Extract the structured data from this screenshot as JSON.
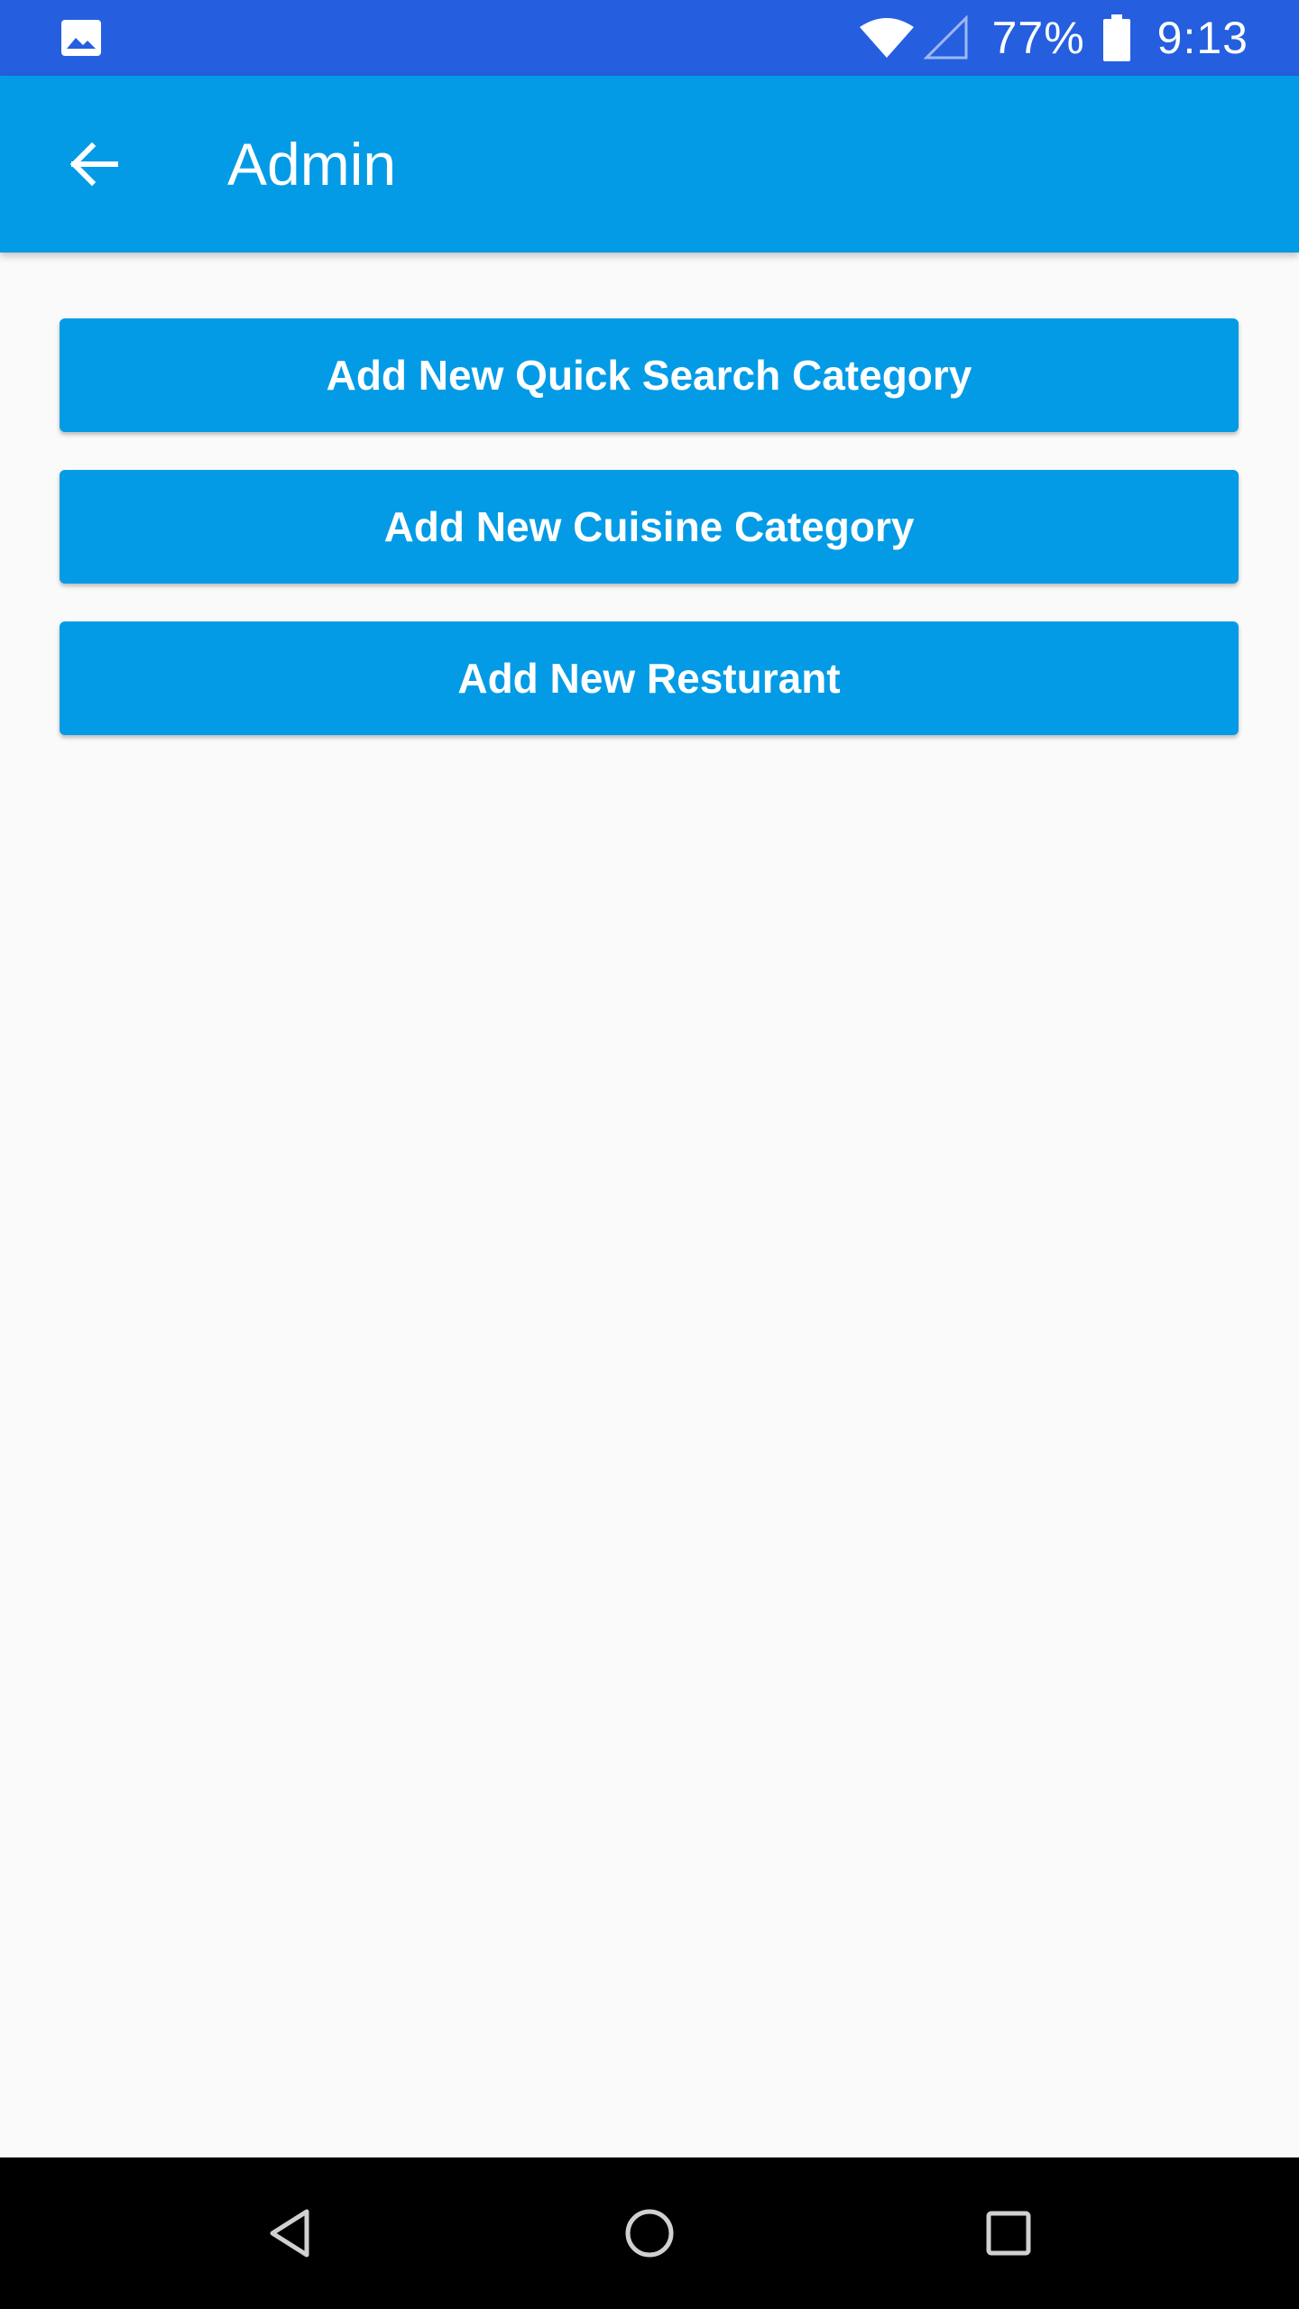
{
  "status_bar": {
    "battery_percent": "77%",
    "time": "9:13",
    "background_color": "#255FDF",
    "icons": [
      "image-icon",
      "wifi-icon",
      "signal-icon",
      "battery-icon"
    ]
  },
  "app_bar": {
    "title": "Admin",
    "background_color": "#039BE5",
    "back_icon": "arrow-back-icon"
  },
  "actions": [
    {
      "label": "Add New Quick Search Category"
    },
    {
      "label": "Add New Cuisine Category"
    },
    {
      "label": "Add New Resturant"
    }
  ],
  "nav_bar": {
    "icons": [
      "nav-back-icon",
      "nav-home-icon",
      "nav-recents-icon"
    ]
  }
}
